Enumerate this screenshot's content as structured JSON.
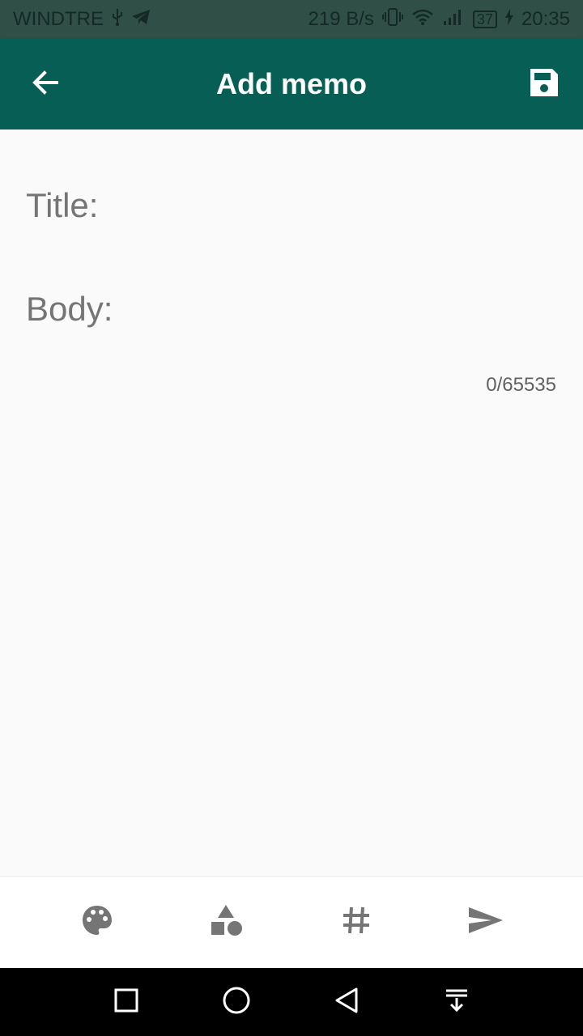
{
  "status_bar": {
    "carrier": "WINDTRE",
    "speed": "219 B/s",
    "battery": "37",
    "time": "20:35"
  },
  "app_bar": {
    "title": "Add memo",
    "back_icon": "arrow-back-icon",
    "save_icon": "save-icon"
  },
  "editor": {
    "title_placeholder": "Title:",
    "body_placeholder": "Body:",
    "char_counter": "0/65535"
  },
  "toolbar": {
    "items": [
      {
        "icon": "palette-icon"
      },
      {
        "icon": "shapes-icon"
      },
      {
        "icon": "hashtag-icon"
      },
      {
        "icon": "send-icon"
      }
    ]
  },
  "nav_bar": {
    "items": [
      {
        "icon": "recents-icon"
      },
      {
        "icon": "home-icon"
      },
      {
        "icon": "back-icon"
      },
      {
        "icon": "notifications-pull-icon"
      }
    ]
  },
  "colors": {
    "status_bar": "#2f4f47",
    "app_bar": "#075e54",
    "background": "#fafafa",
    "icon_gray": "#757575"
  }
}
